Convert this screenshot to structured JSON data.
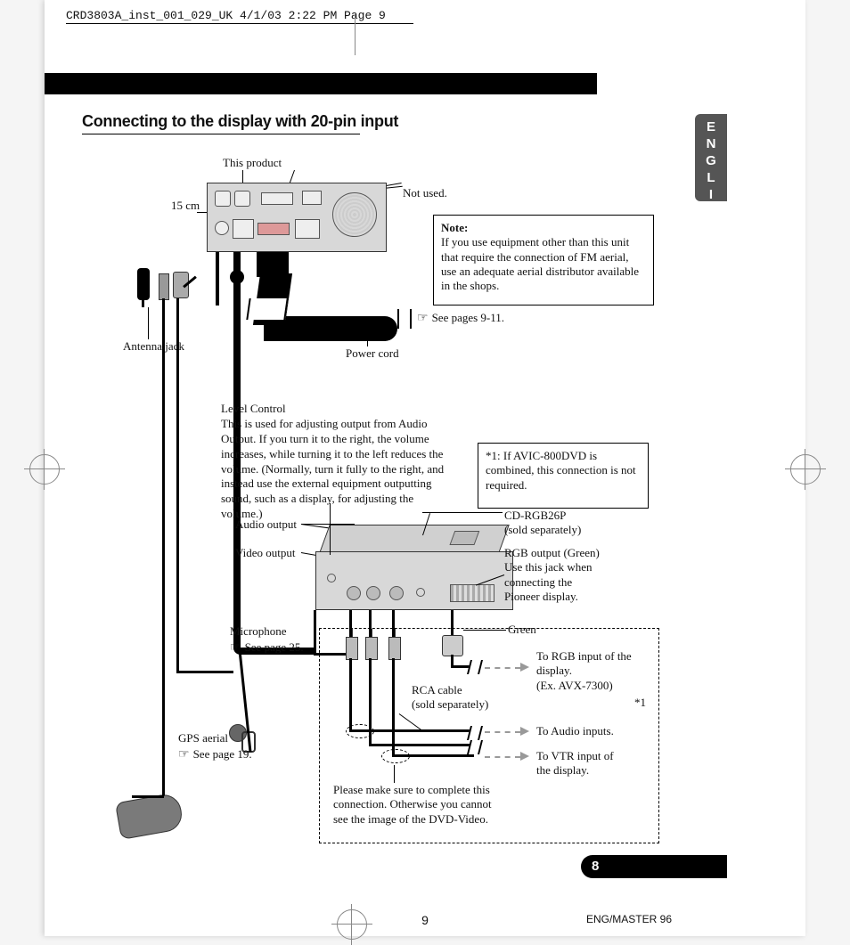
{
  "header": "CRD3803A_inst_001_029_UK  4/1/03 2:22 PM  Page 9",
  "section_title": "Connecting to the display with 20-pin input",
  "language_tab": "ENGLISH",
  "section_number": "8",
  "page_number": "9",
  "footer_code": "ENG/MASTER 96",
  "labels": {
    "this_product": "This product",
    "cm15": "15 cm",
    "not_used": "Not used.",
    "antenna_jack": "Antenna jack",
    "power_cord": "Power cord",
    "see_9_11": "See pages 9-11.",
    "audio_output": "Audio output",
    "video_output": "Video output",
    "microphone": "Microphone",
    "see_25": "See page 25.",
    "gps_aerial": "GPS aerial",
    "see_19": "See page 19.",
    "cd_rgb": "CD-RGB26P\n(sold separately)",
    "rgb_out": "RGB output (Green)\nUse this jack when\nconnecting the\nPioneer display.",
    "green": "Green",
    "rca": "RCA cable\n(sold separately)",
    "to_rgb": "To RGB input of the\ndisplay.\n(Ex. AVX-7300)",
    "star1": "*1",
    "to_audio": "To Audio inputs.",
    "to_vtr": "To VTR input of\nthe display.",
    "dvd_warning": "Please make sure to complete this\nconnection. Otherwise you cannot\nsee the image of the DVD-Video."
  },
  "note": {
    "title": "Note:",
    "body": "If you use equipment other than this unit that require the connection of FM aerial, use an adequate aerial distributor available in the shops."
  },
  "star_note": "*1: If AVIC-800DVD is combined, this connection is not required.",
  "level": {
    "title": "Level Control",
    "body": "This is used for adjusting output from Audio Output. If you turn it to the right, the volume increases, while turning it to the left reduces the volume. (Normally, turn it fully to the right, and instead use the external equipment outputting sound, such as a display, for adjusting the volume.)"
  }
}
